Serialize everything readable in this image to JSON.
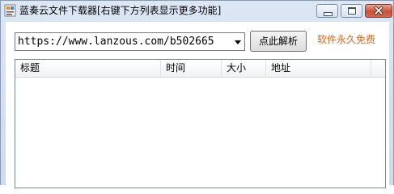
{
  "window": {
    "title": "蓝奏云文件下载器[右键下方列表显示更多功能]",
    "icon": "app-icon"
  },
  "toolbar": {
    "url_value": "https://www.lanzous.com/b502665",
    "parse_button_label": "点此解析",
    "free_label": "软件永久免费"
  },
  "list": {
    "columns": [
      "标题",
      "时间",
      "大小",
      "地址"
    ],
    "rows": []
  },
  "colors": {
    "free_label": "#d2691e",
    "title_bar": "#dce7f5",
    "close_button": "#c7503b"
  }
}
